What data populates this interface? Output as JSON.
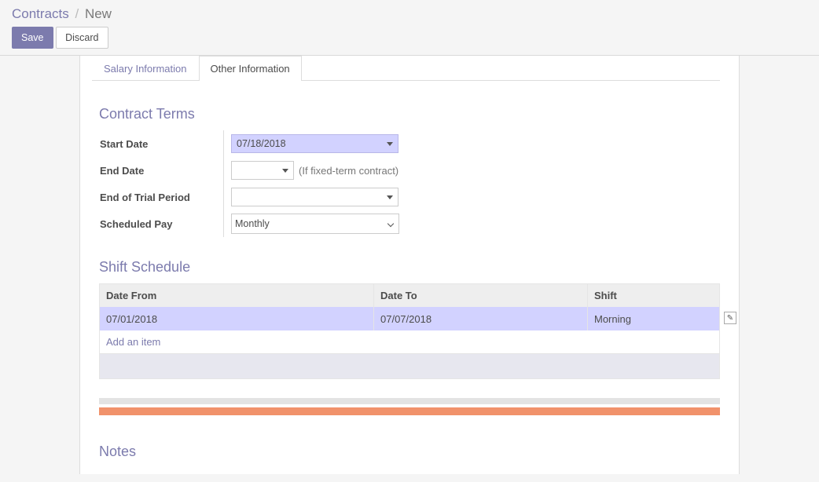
{
  "breadcrumb": {
    "root": "Contracts",
    "current": "New"
  },
  "buttons": {
    "save": "Save",
    "discard": "Discard"
  },
  "tabs": {
    "salary": "Salary Information",
    "other": "Other Information"
  },
  "terms": {
    "heading": "Contract Terms",
    "labels": {
      "start_date": "Start Date",
      "end_date": "End Date",
      "end_trial": "End of Trial Period",
      "scheduled_pay": "Scheduled Pay"
    },
    "start_date": "07/18/2018",
    "end_date": "",
    "end_date_hint": "(If fixed-term contract)",
    "trial_date": "",
    "scheduled_pay": "Monthly"
  },
  "shift": {
    "heading": "Shift Schedule",
    "cols": {
      "from": "Date From",
      "to": "Date To",
      "shift": "Shift"
    },
    "rows": [
      {
        "from": "07/01/2018",
        "to": "07/07/2018",
        "shift": "Morning"
      }
    ],
    "add_item": "Add an item"
  },
  "notes": {
    "heading": "Notes"
  }
}
